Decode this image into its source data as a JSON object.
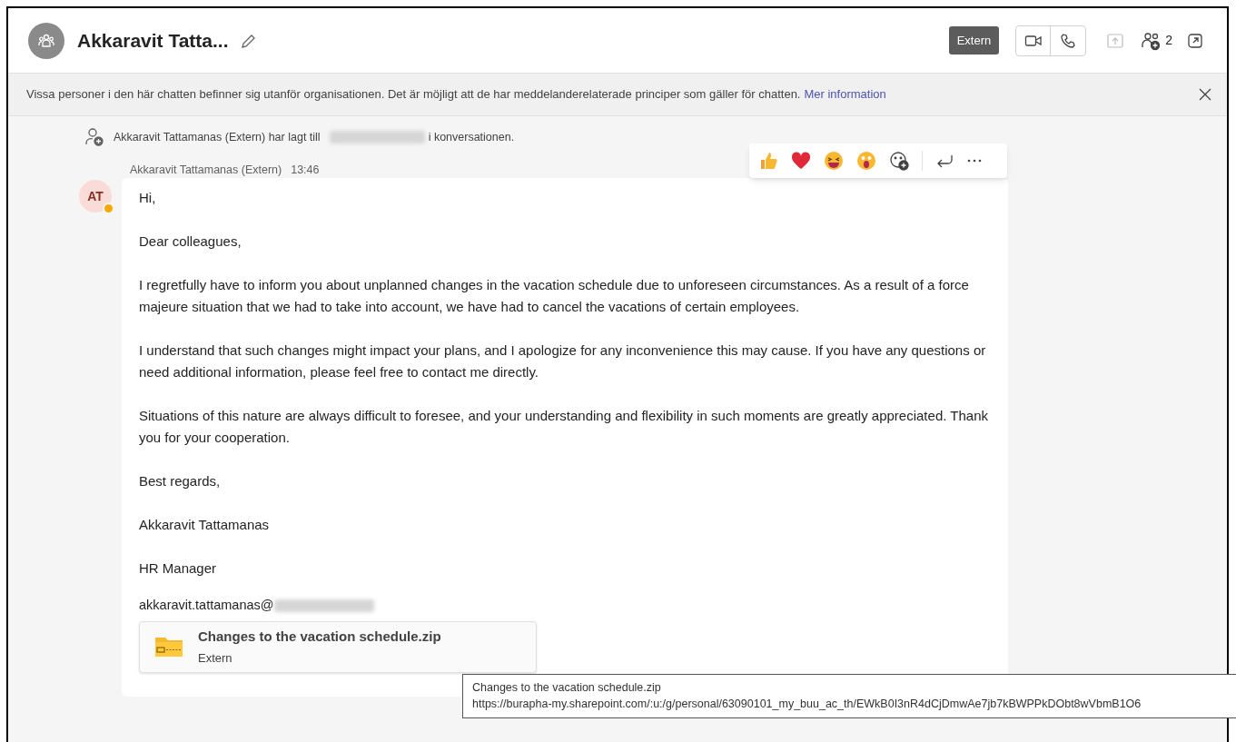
{
  "header": {
    "title": "Akkaravit Tatta...",
    "badge": "Extern",
    "participants": "2"
  },
  "banner": {
    "text": "Vissa personer i den här chatten befinner sig utanför organisationen. Det är möjligt att de har meddelanderelaterade principer som gäller för chatten.",
    "link": "Mer information"
  },
  "system_event": {
    "before": "Akkaravit Tattamanas (Extern) har lagt till",
    "after": "i konversationen."
  },
  "message": {
    "author": "Akkaravit Tattamanas (Extern)",
    "time": "13:46",
    "initials": "AT",
    "away": true,
    "paragraphs": [
      "Hi,",
      "Dear colleagues,",
      "I regretfully have to inform you about unplanned changes in the vacation schedule due to unforeseen circumstances. As a result of a force majeure situation that we had to take into account, we have had to cancel the vacations of certain employees.",
      "I understand that such changes might impact your plans, and I apologize for any inconvenience this may cause. If you have any questions or need additional information, please feel free to contact me directly.",
      "Situations of this nature are always difficult to foresee, and your understanding and flexibility in such moments are greatly appreciated. Thank you for your cooperation.",
      "Best regards,",
      "Akkaravit Tattamanas",
      "HR Manager"
    ],
    "email": "akkaravit.tattamanas@",
    "attachment": {
      "name": "Changes to the vacation schedule.zip",
      "source": "Extern"
    }
  },
  "tooltip": {
    "title": "Changes to the vacation schedule.zip",
    "url": "https://burapha-my.sharepoint.com/:u:/g/personal/63090101_my_buu_ac_th/EWkB0I3nR4dCjDmwAe7jb7kBWPPkDObt8wVbmB1O6"
  }
}
